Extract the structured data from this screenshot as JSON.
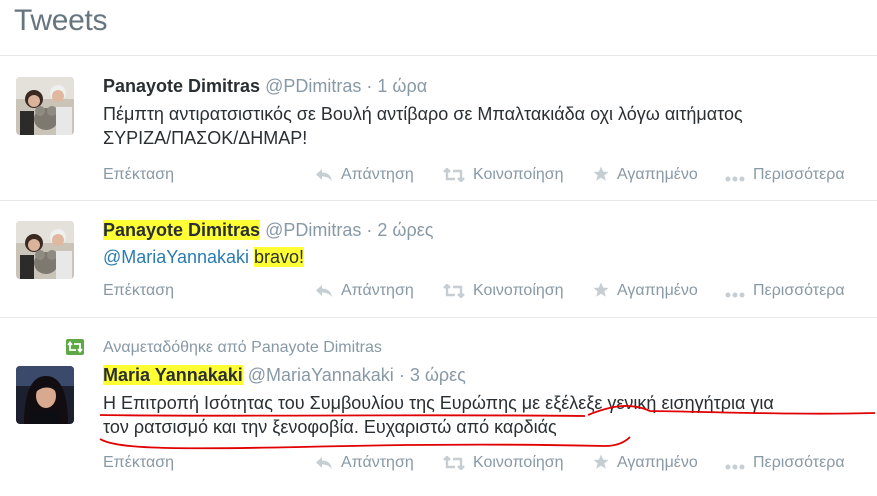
{
  "header": {
    "title": "Tweets"
  },
  "tweets": [
    {
      "author_name": "Panayote Dimitras",
      "author_handle": "@PDimitras",
      "separator": "·",
      "time": "1 ώρα",
      "text_line1": "Πέμπτη αντιρατσιστικός σε Βουλή αντίβαρο σε Μπαλτακιάδα οχι λόγω αιτήματος",
      "text_line2": "ΣΥΡΙΖΑ/ΠΑΣΟΚ/ΔΗΜΑΡ!",
      "expand": "Επέκταση",
      "reply": "Απάντηση",
      "retweet": "Κοινοποίηση",
      "favorite": "Αγαπημένο",
      "more": "Περισσότερα"
    },
    {
      "author_name": "Panayote Dimitras",
      "author_handle": "@PDimitras",
      "separator": "·",
      "time": "2 ώρες",
      "mention": "@MariaYannakaki",
      "text": "bravo!",
      "expand": "Επέκταση",
      "reply": "Απάντηση",
      "retweet": "Κοινοποίηση",
      "favorite": "Αγαπημένο",
      "more": "Περισσότερα"
    },
    {
      "retweet_context": "Αναμεταδόθηκε από Panayote Dimitras",
      "author_name": "Maria Yannakaki",
      "author_handle": "@MariaYannakaki",
      "separator": "·",
      "time": "3 ώρες",
      "text_line1": "Η Επιτροπή Ισότητας του Συμβουλίου της Ευρώπης με εξέλεξε γενική εισηγήτρια για",
      "text_line2": "τον ρατσισμό και την ξενοφοβία. Ευχαριστώ από καρδιάς",
      "expand": "Επέκταση",
      "reply": "Απάντηση",
      "retweet": "Κοινοποίηση",
      "favorite": "Αγαπημένο",
      "more": "Περισσότερα"
    }
  ],
  "colors": {
    "highlight": "#ffff33",
    "mention": "#2a7cb0",
    "underline": "#e00000",
    "retweet_green": "#5ea845"
  }
}
